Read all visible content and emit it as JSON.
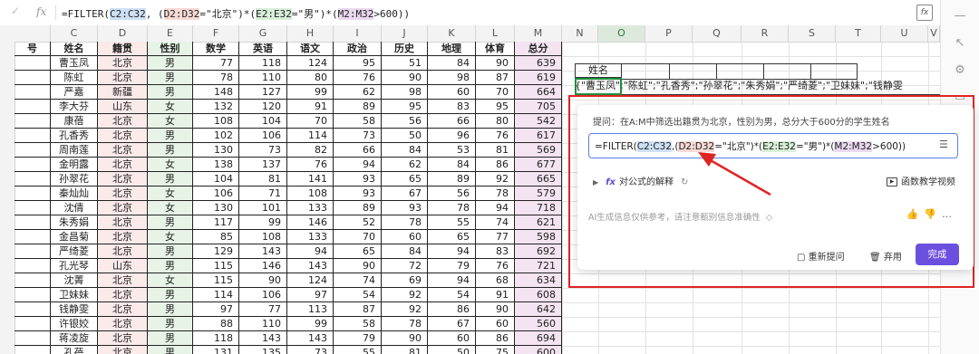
{
  "formula_bar": {
    "check_icon": "✓",
    "fx_label": "fx",
    "formula_parts": [
      "=FILTER(",
      "C2:C32",
      ", (",
      "D2:D32",
      "=\"北京\")*(",
      "E2:E32",
      "=\"男\")*(",
      "M2:M32",
      ">600))"
    ]
  },
  "columns": [
    "C",
    "D",
    "E",
    "F",
    "G",
    "H",
    "I",
    "J",
    "K",
    "L",
    "M",
    "N",
    "O",
    "P",
    "Q",
    "R",
    "S",
    "T",
    "U",
    "V"
  ],
  "table": {
    "headers": [
      "号",
      "姓名",
      "籍贯",
      "性别",
      "数学",
      "英语",
      "语文",
      "政治",
      "历史",
      "地理",
      "体育",
      "总分"
    ],
    "rows": [
      [
        "曹玉凤",
        "北京",
        "男",
        "77",
        "118",
        "124",
        "95",
        "51",
        "84",
        "90",
        "639"
      ],
      [
        "陈虹",
        "北京",
        "男",
        "78",
        "110",
        "80",
        "76",
        "90",
        "98",
        "87",
        "619"
      ],
      [
        "严嘉",
        "新疆",
        "男",
        "148",
        "127",
        "99",
        "62",
        "98",
        "60",
        "70",
        "664"
      ],
      [
        "李大芬",
        "山东",
        "女",
        "132",
        "120",
        "91",
        "89",
        "95",
        "83",
        "95",
        "705"
      ],
      [
        "康蓓",
        "北京",
        "女",
        "108",
        "104",
        "70",
        "58",
        "56",
        "66",
        "80",
        "542"
      ],
      [
        "孔香秀",
        "北京",
        "男",
        "102",
        "106",
        "114",
        "73",
        "50",
        "96",
        "76",
        "617"
      ],
      [
        "周南莲",
        "北京",
        "男",
        "130",
        "73",
        "82",
        "66",
        "84",
        "53",
        "81",
        "569"
      ],
      [
        "金明露",
        "北京",
        "女",
        "138",
        "137",
        "76",
        "94",
        "62",
        "84",
        "86",
        "677"
      ],
      [
        "孙翠花",
        "北京",
        "男",
        "104",
        "81",
        "141",
        "93",
        "65",
        "89",
        "92",
        "665"
      ],
      [
        "秦灿灿",
        "北京",
        "女",
        "106",
        "71",
        "108",
        "93",
        "67",
        "56",
        "78",
        "579"
      ],
      [
        "沈倩",
        "北京",
        "女",
        "130",
        "101",
        "133",
        "89",
        "93",
        "78",
        "94",
        "718"
      ],
      [
        "朱秀娟",
        "北京",
        "男",
        "117",
        "99",
        "146",
        "52",
        "78",
        "55",
        "74",
        "621"
      ],
      [
        "金昌菊",
        "北京",
        "女",
        "85",
        "108",
        "133",
        "70",
        "60",
        "65",
        "77",
        "598"
      ],
      [
        "严绮菱",
        "北京",
        "男",
        "129",
        "143",
        "94",
        "65",
        "84",
        "94",
        "83",
        "692"
      ],
      [
        "孔光琴",
        "山东",
        "男",
        "115",
        "146",
        "143",
        "90",
        "72",
        "79",
        "76",
        "721"
      ],
      [
        "沈菁",
        "北京",
        "女",
        "115",
        "90",
        "124",
        "74",
        "69",
        "94",
        "68",
        "634"
      ],
      [
        "卫妹妹",
        "北京",
        "男",
        "114",
        "106",
        "97",
        "54",
        "92",
        "54",
        "91",
        "608"
      ],
      [
        "钱静雯",
        "北京",
        "男",
        "97",
        "77",
        "113",
        "87",
        "92",
        "86",
        "90",
        "642"
      ],
      [
        "许银姣",
        "北京",
        "男",
        "88",
        "110",
        "99",
        "58",
        "78",
        "67",
        "60",
        "560"
      ],
      [
        "蒋凌旋",
        "北京",
        "男",
        "118",
        "143",
        "143",
        "79",
        "90",
        "60",
        "86",
        "694"
      ],
      [
        "孔蓓",
        "北京",
        "男",
        "131",
        "135",
        "73",
        "55",
        "81",
        "50",
        "75",
        "600"
      ]
    ]
  },
  "result_area": {
    "header": "姓名",
    "result_text": "{\"曹玉凤\";\"陈虹\";\"孔香秀\";\"孙翠花\";\"朱秀娟\";\"严绮菱\";\"卫妹妹\";\"钱静雯"
  },
  "ai_panel": {
    "question": "提问：在A:M中筛选出籍贯为北京，性别为男，总分大于600分的学生姓名",
    "formula_parts": [
      "=FILTER(",
      "C2:C32",
      ",(",
      "D2:D32",
      "=\"北京\")*(",
      "E2:E32",
      "=\"男\")*(",
      "M2:M32",
      ">600))"
    ],
    "explain_label": "对公式的解释",
    "video_label": "函数教学视频",
    "disclaimer": "AI生成信息仅供参考，请注意甄别信息准确性",
    "regenerate_label": "重新提问",
    "discard_label": "弃用",
    "done_label": "完成"
  },
  "colors": {
    "accent": "#6b50e0",
    "annotation_red": "#e02424",
    "range_blue": "#cfe0f5",
    "range_red": "#f6d9d6",
    "range_green": "#d8efd8",
    "range_purple": "#ead9ef"
  }
}
